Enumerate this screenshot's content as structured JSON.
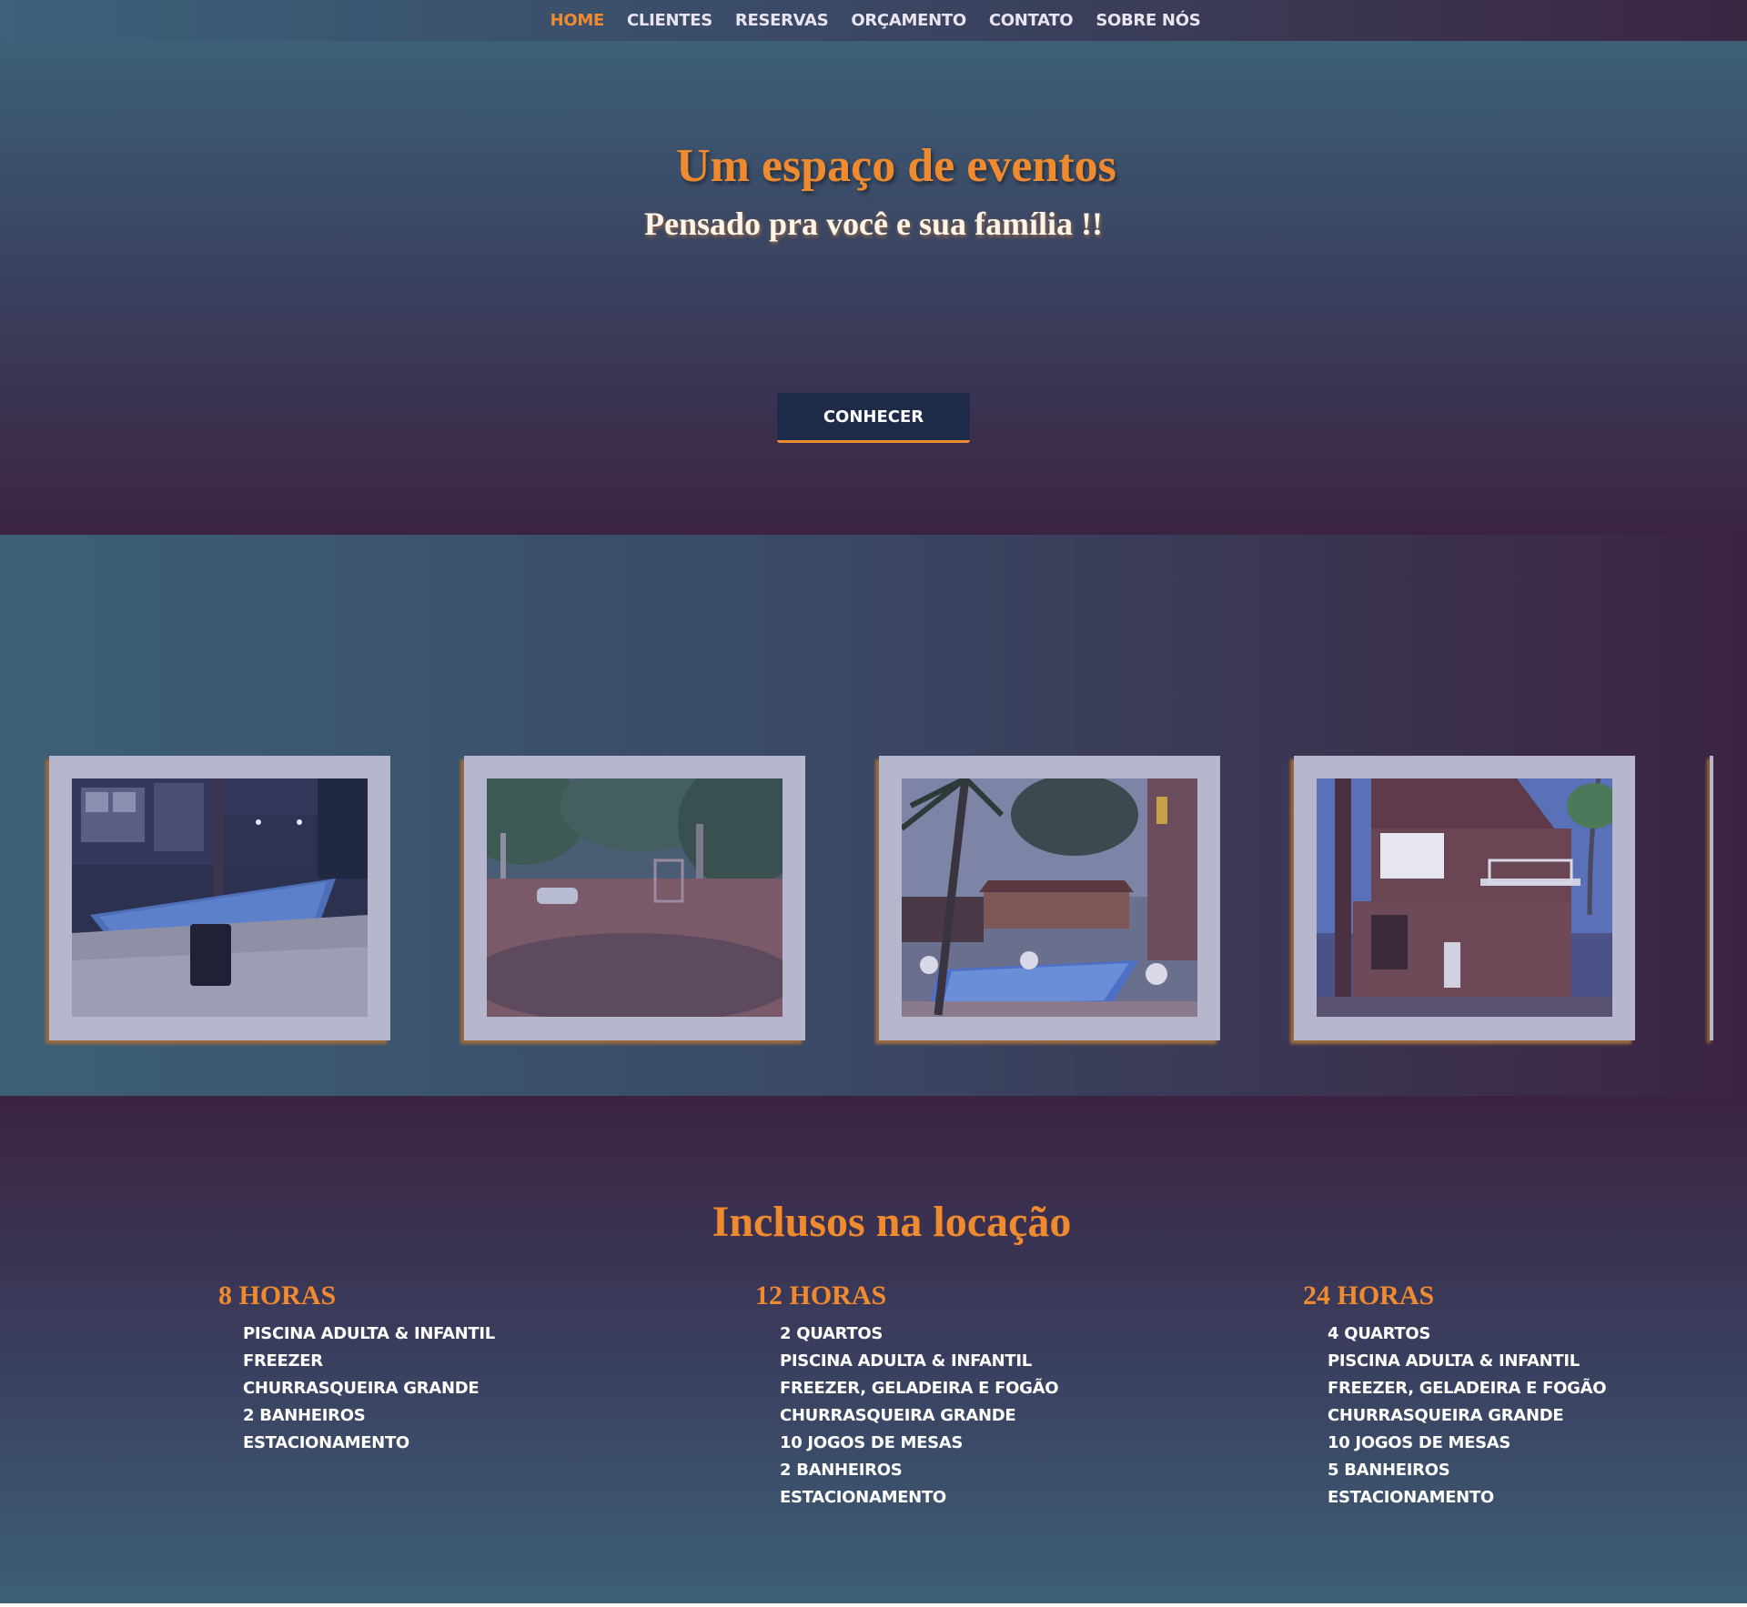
{
  "nav": {
    "items": [
      {
        "label": "HOME",
        "active": true
      },
      {
        "label": "CLIENTES",
        "active": false
      },
      {
        "label": "RESERVAS",
        "active": false
      },
      {
        "label": "ORÇAMENTO",
        "active": false
      },
      {
        "label": "CONTATO",
        "active": false
      },
      {
        "label": "SOBRE NÓS",
        "active": false
      }
    ]
  },
  "hero": {
    "title": "Um espaço de eventos",
    "subtitle": "Pensado pra você e sua família !!",
    "button_label": "CONHECER"
  },
  "gallery": {
    "photos": [
      {
        "subject": "pool-at-night"
      },
      {
        "subject": "yard-with-trees-and-car"
      },
      {
        "subject": "pool-with-tables-and-palm"
      },
      {
        "subject": "two-story-house"
      }
    ]
  },
  "included": {
    "title": "Inclusos na locação",
    "plans": [
      {
        "title": "8 HORAS",
        "items": [
          "PISCINA ADULTA & INFANTIL",
          "FREEZER",
          "CHURRASQUEIRA GRANDE",
          "2 BANHEIROS",
          "ESTACIONAMENTO"
        ]
      },
      {
        "title": "12 HORAS",
        "items": [
          "2 QUARTOS",
          "PISCINA ADULTA & INFANTIL",
          "FREEZER, GELADEIRA E FOGÃO",
          "CHURRASQUEIRA GRANDE",
          "10 JOGOS DE MESAS",
          "2 BANHEIROS",
          "ESTACIONAMENTO"
        ]
      },
      {
        "title": "24 HORAS",
        "items": [
          "4 QUARTOS",
          "PISCINA ADULTA & INFANTIL",
          "FREEZER, GELADEIRA E FOGÃO",
          "CHURRASQUEIRA GRANDE",
          "10 JOGOS DE MESAS",
          "5 BANHEIROS",
          "ESTACIONAMENTO"
        ]
      }
    ]
  },
  "colors": {
    "accent": "#f08a2e",
    "teal": "#3d6076",
    "plum": "#3b2442",
    "button_bg": "#1d2a48",
    "frame": "#b6b7cc"
  }
}
